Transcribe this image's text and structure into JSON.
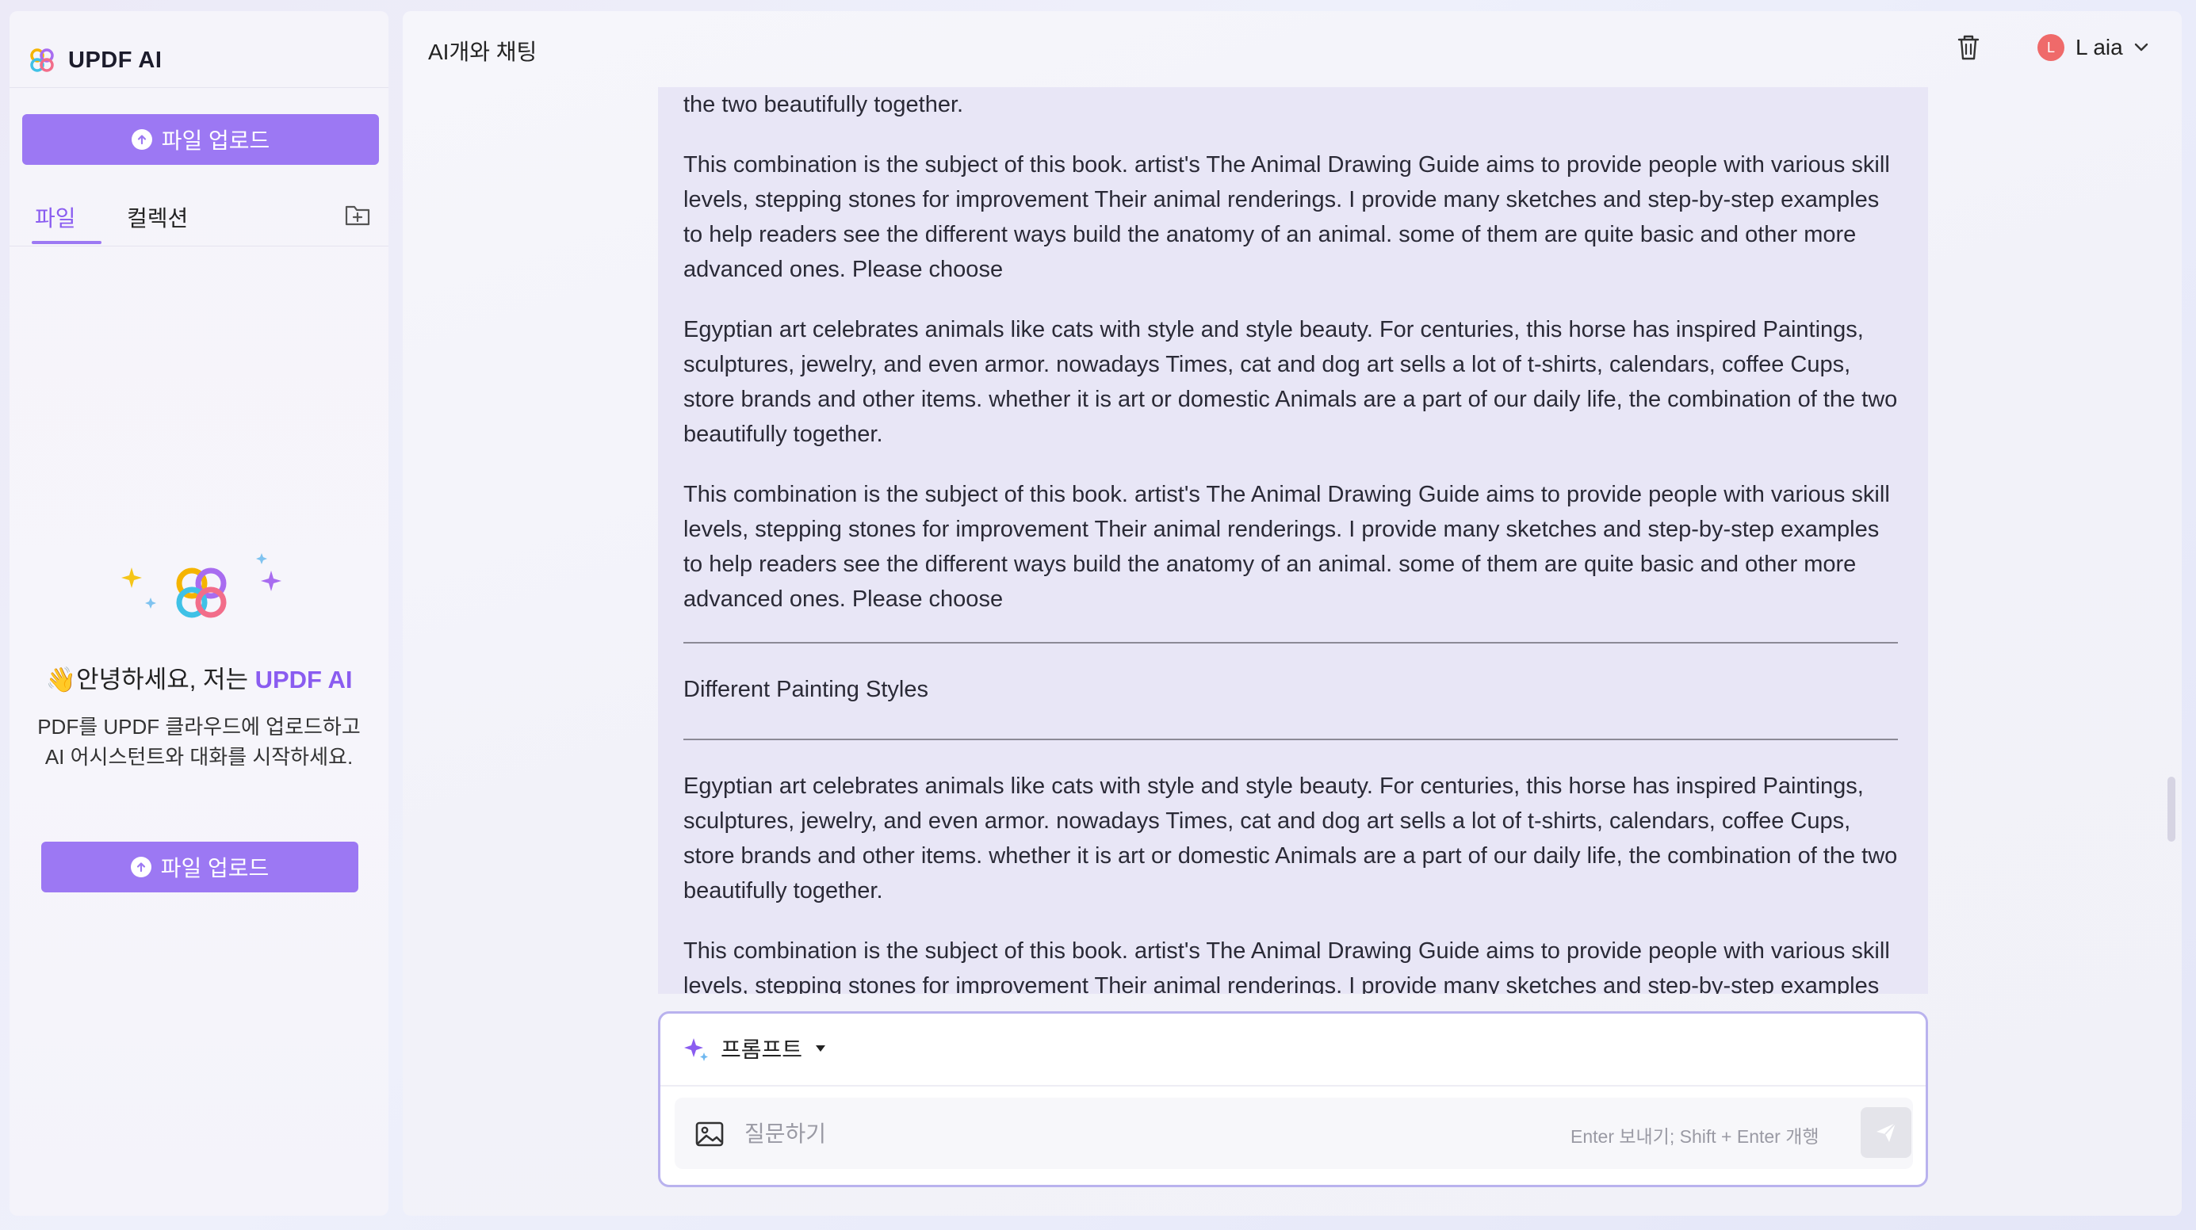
{
  "app": {
    "name": "UPDF AI"
  },
  "sidebar": {
    "upload_label": "파일 업로드",
    "tabs": [
      {
        "label": "파일",
        "active": true
      },
      {
        "label": "컬렉션",
        "active": false
      }
    ],
    "empty_state": {
      "greeting_prefix": "👋안녕하세요, 저는 ",
      "greeting_brand": "UPDF AI",
      "description": "PDF를 UPDF 클라우드에 업로드하고 AI 어시스턴트와 대화를 시작하세요.",
      "upload_label": "파일 업로드"
    }
  },
  "header": {
    "title": "AI개와 채팅",
    "user": {
      "avatar_letter": "L",
      "name": "L aia"
    }
  },
  "chat": {
    "paragraphs_top": [
      "Cups, store brands and other items. whether it is art or domestic Animals are a part of our daily life, the combination of the two beautifully together.",
      "This combination is the subject of this book. artist's The Animal Drawing Guide aims to provide people with various skill levels, stepping stones for improvement Their animal renderings. I provide many sketches and step-by-step examples to help readers see the different ways build the anatomy of an animal. some of them are quite basic and other more advanced ones. Please choose",
      "Egyptian art celebrates animals like cats with style and style beauty. For centuries, this horse has inspired Paintings, sculptures, jewelry, and even armor. nowadays Times, cat and dog art sells a lot of t-shirts, calendars, coffee Cups, store brands and other items. whether it is art or domestic Animals are a part of our daily life, the combination of the two beautifully together.",
      "This combination is the subject of this book. artist's The Animal Drawing Guide aims to provide people with various skill levels, stepping stones for improvement Their animal renderings. I provide many sketches and step-by-step examples to help readers see the different ways build the anatomy of an animal. some of them are quite basic and other more advanced ones. Please choose"
    ],
    "section_heading": "Different Painting Styles",
    "paragraphs_bottom": [
      "Egyptian art celebrates animals like cats with style and style beauty. For centuries, this horse has inspired Paintings, sculptures, jewelry, and even armor. nowadays Times, cat and dog art sells a lot of t-shirts, calendars, coffee Cups, store brands and other items. whether it is art or domestic Animals are a part of our daily life, the combination of the two beautifully together.",
      "This combination is the subject of this book. artist's The Animal Drawing Guide aims to provide people with various skill levels, stepping stones for improvement Their animal renderings. I provide many sketches and step-by-step examples to help readers see the different ways build the anatomy of an animal. some of them are quite basic and other more advanced ones. Please choose"
    ]
  },
  "composer": {
    "prompt_label": "프롬프트",
    "input_value": "",
    "input_placeholder": "질문하기",
    "hint": "Enter 보내기; Shift + Enter 개행"
  },
  "colors": {
    "accent": "#9c78f3",
    "accent_text": "#8a5cf0",
    "avatar": "#ef6a6a"
  },
  "icons": [
    "updf-logo-icon",
    "upload-icon",
    "new-folder-icon",
    "trash-icon",
    "chevron-down-icon",
    "sparkle-icon",
    "caret-down-icon",
    "image-icon",
    "send-icon"
  ]
}
